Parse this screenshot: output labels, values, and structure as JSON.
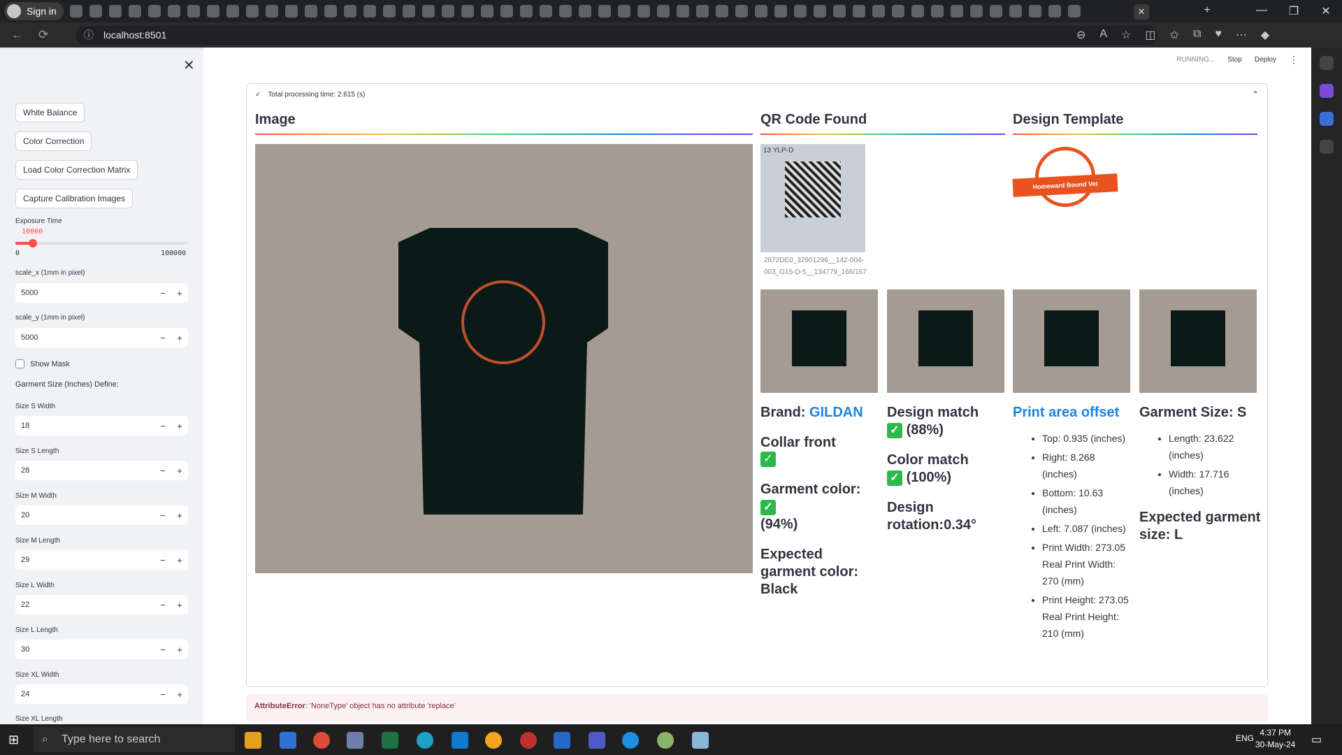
{
  "browser": {
    "profile_label": "Sign in",
    "url": "localhost:8501",
    "active_tab_close": "✕"
  },
  "header": {
    "status": "RUNNING...",
    "stop_label": "Stop",
    "deploy_label": "Deploy",
    "menu_icon": "⋮"
  },
  "sidebar": {
    "close_icon": "✕",
    "buttons": [
      "White Balance",
      "Color Correction",
      "Load Color Correction Matrix",
      "Capture Calibration Images"
    ],
    "exposure": {
      "label": "Exposure Time",
      "value": "10000",
      "min": "0",
      "max": "100000",
      "fraction": 0.1
    },
    "scale_x": {
      "label": "scale_x (1mm in pixel)",
      "value": "5000"
    },
    "scale_y": {
      "label": "scale_y (1mm in pixel)",
      "value": "5000"
    },
    "show_mask": {
      "label": "Show Mask",
      "checked": false
    },
    "garment_title": "Garment Size (Inches) Define:",
    "sizes": [
      {
        "label": "Size S Width",
        "value": "18"
      },
      {
        "label": "Size S Length",
        "value": "28"
      },
      {
        "label": "Size M Width",
        "value": "20"
      },
      {
        "label": "Size M Length",
        "value": "29"
      },
      {
        "label": "Size L Width",
        "value": "22"
      },
      {
        "label": "Size L Length",
        "value": "30"
      },
      {
        "label": "Size XL Width",
        "value": "24"
      },
      {
        "label": "Size XL Length",
        "value": ""
      }
    ],
    "minus": "−",
    "plus": "+"
  },
  "expander": {
    "title": "Total processing time: 2.615 (s)",
    "check_icon": "✓",
    "chevron": "⌃"
  },
  "columns": {
    "image_title": "Image",
    "qr_title": "QR Code Found",
    "template_title": "Design Template",
    "qr_caption": "2872DE0_32901296__142-004-003_G15-D-5__134779_166/167",
    "qr_text": "13 YLP-D",
    "logo_text": "Homeward Bound Vet"
  },
  "results": {
    "brand_label": "Brand: ",
    "brand_value": "GILDAN",
    "collar_label": "Collar front",
    "garment_color_label": "Garment color:",
    "garment_color_pct": "(94%)",
    "expected_color": "Expected garment color: Black",
    "design_match_label": "Design match",
    "design_match_pct": "(88%)",
    "color_match_label": "Color match",
    "color_match_pct": "(100%)",
    "design_rotation": "Design rotation:0.34°",
    "offset_title": "Print area offset",
    "offset_items": [
      "Top: 0.935 (inches)",
      "Right: 8.268 (inches)",
      "Bottom: 10.63 (inches)",
      "Left: 7.087 (inches)",
      "Print Width: 273.05 Real Print Width: 270 (mm)",
      "Print Height: 273.05 Real Print Height: 210 (mm)"
    ],
    "size_title": "Garment Size: S",
    "size_items": [
      "Length: 23.622 (inches)",
      "Width: 17.716 (inches)"
    ],
    "expected_size": "Expected garment size: L",
    "check": "✓"
  },
  "error": {
    "type": "AttributeError",
    "message": ": 'NoneType' object has no attribute 'replace'"
  },
  "taskbar": {
    "search_placeholder": "Type here to search",
    "lang": "ENG",
    "time": "4:37 PM",
    "date": "30-May-24"
  },
  "colors": {
    "accent": "#ff4b4b",
    "link": "#1c83e1",
    "check": "#2db84c"
  }
}
